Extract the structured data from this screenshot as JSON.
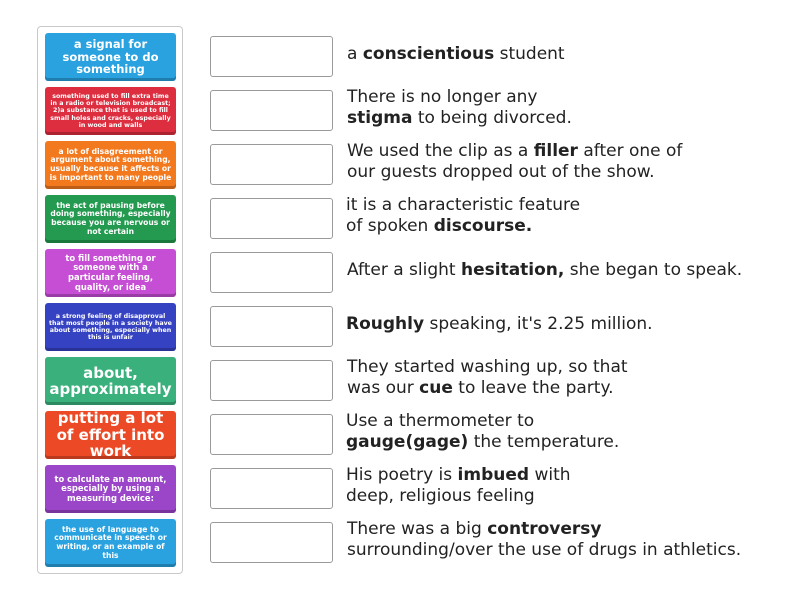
{
  "tiles": [
    {
      "text": "a signal for someone to do something",
      "color": "#2aa2e0",
      "size": "fs-l"
    },
    {
      "text": "something used to fill extra time in a radio or television broadcast; 2)a substance that is used to fill small holes and cracks, especially in wood and walls",
      "color": "#dc2e3f",
      "size": "fs-xs"
    },
    {
      "text": "a lot of disagreement or argument about something, usually because it affects or is important to many people",
      "color": "#f3791f",
      "size": "fs-s"
    },
    {
      "text": "the act of pausing before doing something, especially because you are nervous or not certain",
      "color": "#239a4f",
      "size": "fs-s"
    },
    {
      "text": "to fill something or someone with a particular feeling, quality, or idea",
      "color": "#c64ed4",
      "size": "fs-m"
    },
    {
      "text": "a strong feeling of disapproval that most people in a society have about something, especially when this is unfair",
      "color": "#3542c2",
      "size": "fs-xs"
    },
    {
      "text": "about, approximately",
      "color": "#3ab07c",
      "size": "fs-xl"
    },
    {
      "text": "putting a lot of effort into work",
      "color": "#ec4a26",
      "size": "fs-xl"
    },
    {
      "text": "to calculate an amount, especially by using a measuring device:",
      "color": "#9b45c9",
      "size": "fs-m"
    },
    {
      "text": "the use of language to communicate in speech or writing, or an example of this",
      "color": "#2aa2e0",
      "size": "fs-s"
    }
  ],
  "sentences": [
    {
      "line1_pre": "a ",
      "line1_bold": "conscientious",
      "line1_post": " student",
      "line2_pre": "",
      "line2_bold": "",
      "line2_post": ""
    },
    {
      "line1_pre": "There is no longer any",
      "line1_bold": "",
      "line1_post": "",
      "line2_pre": "",
      "line2_bold": "stigma",
      "line2_post": " to being divorced."
    },
    {
      "line1_pre": "We used the clip as a ",
      "line1_bold": "filler",
      "line1_post": " after one of",
      "line2_pre": "our guests dropped out of the show.",
      "line2_bold": "",
      "line2_post": ""
    },
    {
      "line1_pre": "it is a characteristic feature",
      "line1_bold": "",
      "line1_post": "",
      "line2_pre": "of spoken ",
      "line2_bold": "discourse.",
      "line2_post": ""
    },
    {
      "line1_pre": "After a slight ",
      "line1_bold": "hesitation,",
      "line1_post": " she began to speak.",
      "line2_pre": "",
      "line2_bold": "",
      "line2_post": ""
    },
    {
      "line1_pre": "",
      "line1_bold": "Roughly",
      "line1_post": " speaking, it's 2.25 million.",
      "line2_pre": "",
      "line2_bold": "",
      "line2_post": ""
    },
    {
      "line1_pre": "They started washing up, so that",
      "line1_bold": "",
      "line1_post": "",
      "line2_pre": "was our ",
      "line2_bold": "cue",
      "line2_post": " to leave the party."
    },
    {
      "line1_pre": "Use a thermometer to",
      "line1_bold": "",
      "line1_post": "",
      "line2_pre": "",
      "line2_bold": "gauge(gage)",
      "line2_post": " the temperature."
    },
    {
      "line1_pre": "His poetry is ",
      "line1_bold": "imbued",
      "line1_post": " with",
      "line2_pre": "deep, religious feeling",
      "line2_bold": "",
      "line2_post": ""
    },
    {
      "line1_pre": "There was a big ",
      "line1_bold": "controversy",
      "line1_post": "",
      "line2_pre": "surrounding/over the use of drugs in athletics.",
      "line2_bold": "",
      "line2_post": ""
    }
  ]
}
